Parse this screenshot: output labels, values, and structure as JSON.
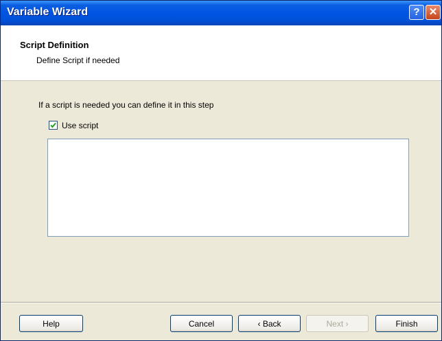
{
  "window": {
    "title": "Variable Wizard",
    "help_glyph": "?",
    "close_glyph": "✕"
  },
  "header": {
    "title": "Script Definition",
    "subtitle": "Define Script if needed"
  },
  "body": {
    "instruction": "If a script is needed you can define it in this step",
    "use_script": {
      "label": "Use script",
      "checked": true
    },
    "script_text": ""
  },
  "buttons": {
    "help": "Help",
    "cancel": "Cancel",
    "back": "‹ Back",
    "next": "Next ›",
    "finish": "Finish"
  },
  "colors": {
    "title_bar": "#0054e3",
    "dialog_bg": "#ece9d8",
    "check_mark": "#21a121"
  }
}
